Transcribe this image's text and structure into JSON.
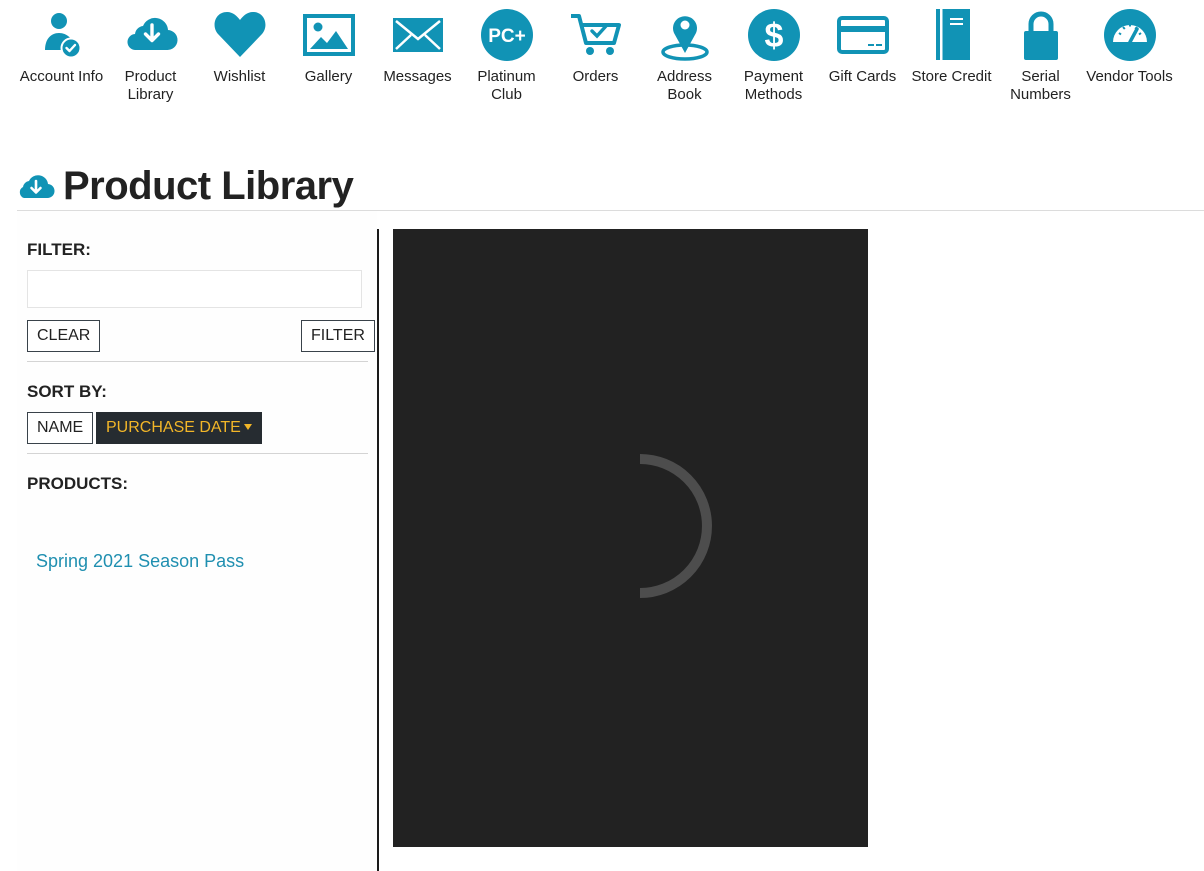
{
  "nav": {
    "items": [
      {
        "label_lines": [
          "Account Info",
          ""
        ],
        "icon": "account-info-icon"
      },
      {
        "label_lines": [
          "Product",
          "Library"
        ],
        "icon": "cloud-download-icon"
      },
      {
        "label_lines": [
          "Wishlist",
          ""
        ],
        "icon": "heart-icon"
      },
      {
        "label_lines": [
          "Gallery",
          ""
        ],
        "icon": "image-icon"
      },
      {
        "label_lines": [
          "Messages",
          ""
        ],
        "icon": "envelope-icon"
      },
      {
        "label_lines": [
          "Platinum",
          "Club"
        ],
        "icon": "platinum-club-icon"
      },
      {
        "label_lines": [
          "Orders",
          ""
        ],
        "icon": "cart-icon"
      },
      {
        "label_lines": [
          "Address",
          "Book"
        ],
        "icon": "map-pin-icon"
      },
      {
        "label_lines": [
          "Payment",
          "Methods"
        ],
        "icon": "dollar-icon"
      },
      {
        "label_lines": [
          "Gift Cards",
          ""
        ],
        "icon": "credit-card-icon"
      },
      {
        "label_lines": [
          "Store Credit",
          ""
        ],
        "icon": "book-icon"
      },
      {
        "label_lines": [
          "Serial",
          "Numbers"
        ],
        "icon": "lock-icon"
      },
      {
        "label_lines": [
          "Vendor Tools",
          ""
        ],
        "icon": "gauge-icon"
      }
    ]
  },
  "page": {
    "title": "Product Library",
    "title_icon": "cloud-download-icon"
  },
  "sidebar": {
    "filter_label": "FILTER:",
    "filter_value": "",
    "filter_placeholder": "",
    "clear_label": "CLEAR",
    "filter_button_label": "FILTER",
    "sort_label": "SORT BY:",
    "sort_name_label": "NAME",
    "sort_date_label": "PURCHASE DATE",
    "products_label": "PRODUCTS:",
    "products": [
      "Spring 2021 Season Pass"
    ]
  },
  "colors": {
    "accent": "#1193b5",
    "link": "#1f8fb0",
    "active_sort_bg": "#262c31",
    "active_sort_text": "#f2b628",
    "viewer_bg": "#222222"
  }
}
